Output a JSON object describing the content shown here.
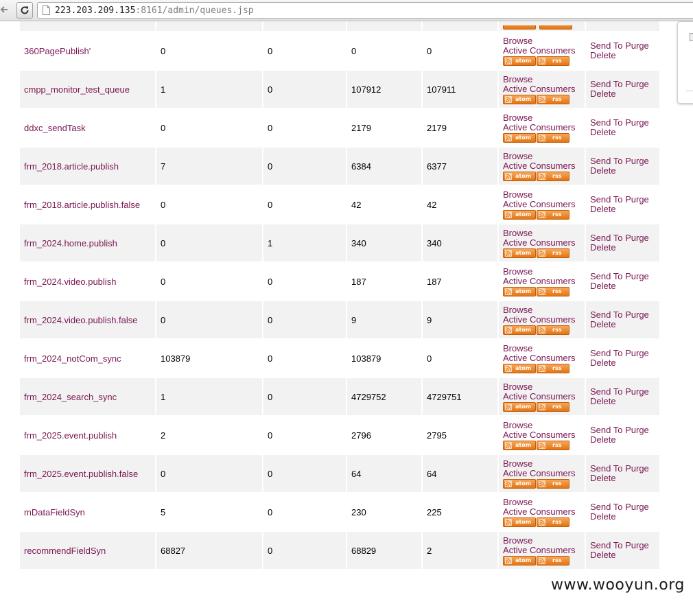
{
  "browser": {
    "url_host": "223.203.209.135",
    "url_rest": ":8161/admin/queues.jsp"
  },
  "feeds": {
    "atom_label": "atom",
    "rss_label": "rss"
  },
  "actions": {
    "browse_label": "Browse",
    "active_consumers_label": "Active Consumers",
    "send_to_label": "Send To",
    "purge_label": "Purge",
    "delete_label": "Delete"
  },
  "queues": [
    {
      "name": "360PagePublish'",
      "pending": "0",
      "consumers": "0",
      "enqueued": "0",
      "dequeued": "0"
    },
    {
      "name": "cmpp_monitor_test_queue",
      "pending": "1",
      "consumers": "0",
      "enqueued": "107912",
      "dequeued": "107911"
    },
    {
      "name": "ddxc_sendTask",
      "pending": "0",
      "consumers": "0",
      "enqueued": "2179",
      "dequeued": "2179"
    },
    {
      "name": "frm_2018.article.publish",
      "pending": "7",
      "consumers": "0",
      "enqueued": "6384",
      "dequeued": "6377"
    },
    {
      "name": "frm_2018.article.publish.false",
      "pending": "0",
      "consumers": "0",
      "enqueued": "42",
      "dequeued": "42"
    },
    {
      "name": "frm_2024.home.publish",
      "pending": "0",
      "consumers": "1",
      "enqueued": "340",
      "dequeued": "340"
    },
    {
      "name": "frm_2024.video.publish",
      "pending": "0",
      "consumers": "0",
      "enqueued": "187",
      "dequeued": "187"
    },
    {
      "name": "frm_2024.video.publish.false",
      "pending": "0",
      "consumers": "0",
      "enqueued": "9",
      "dequeued": "9"
    },
    {
      "name": "frm_2024_notCom_sync",
      "pending": "103879",
      "consumers": "0",
      "enqueued": "103879",
      "dequeued": "0"
    },
    {
      "name": "frm_2024_search_sync",
      "pending": "1",
      "consumers": "0",
      "enqueued": "4729752",
      "dequeued": "4729751"
    },
    {
      "name": "frm_2025.event.publish",
      "pending": "2",
      "consumers": "0",
      "enqueued": "2796",
      "dequeued": "2795"
    },
    {
      "name": "frm_2025.event.publish.false",
      "pending": "0",
      "consumers": "0",
      "enqueued": "64",
      "dequeued": "64"
    },
    {
      "name": "mDataFieldSyn",
      "pending": "5",
      "consumers": "0",
      "enqueued": "230",
      "dequeued": "225"
    },
    {
      "name": "recommendFieldSyn",
      "pending": "68827",
      "consumers": "0",
      "enqueued": "68829",
      "dequeued": "2"
    }
  ],
  "watermark": "www.wooyun.org"
}
